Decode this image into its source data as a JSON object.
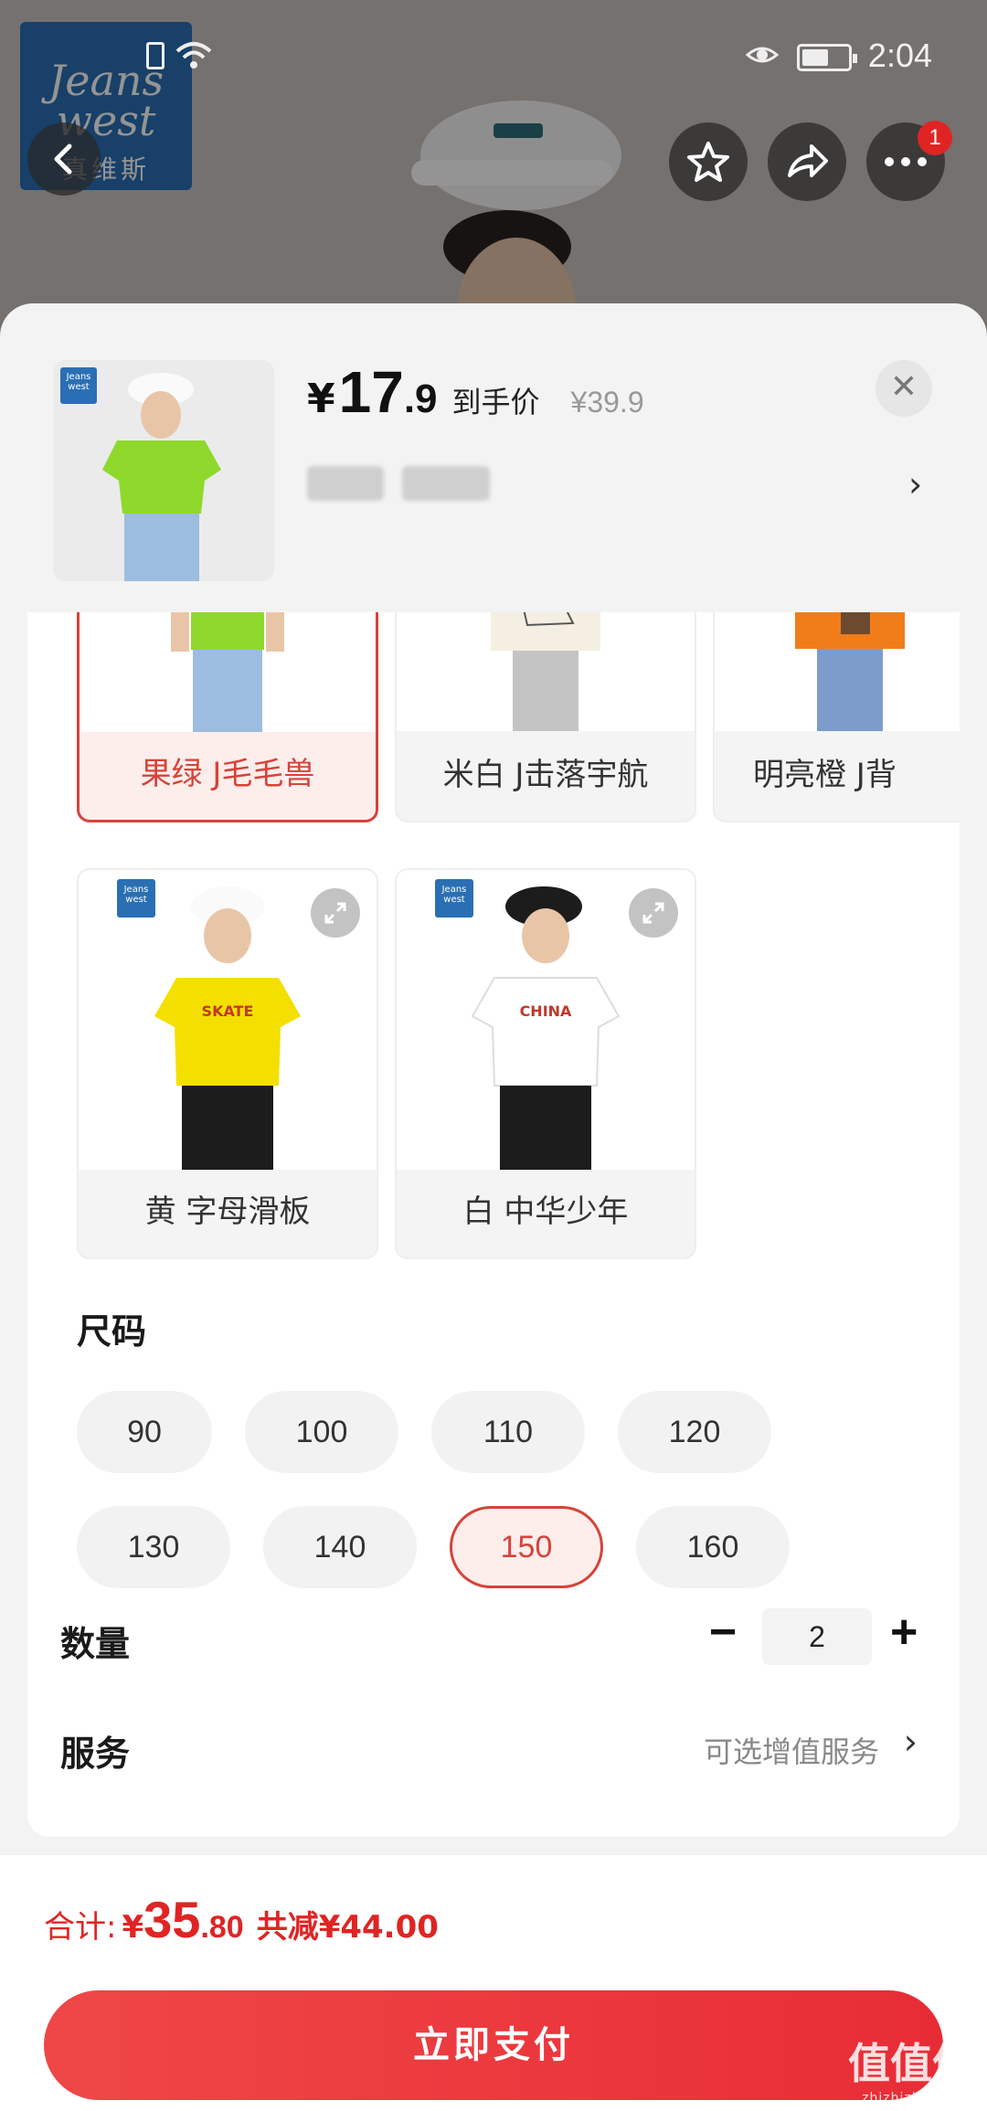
{
  "status_bar": {
    "time": "2:04"
  },
  "brand": {
    "logo_line1": "Jeans",
    "logo_line2": "west",
    "logo_cn": "真维斯"
  },
  "cart_badge": "1",
  "sheet": {
    "price_currency": "¥",
    "price_int": "17",
    "price_dec": ".9",
    "price_tag": "到手价",
    "original_price": "¥39.9",
    "close_icon": "✕"
  },
  "colors": [
    {
      "label": "果绿 J毛毛兽",
      "selected": true,
      "shirt": "#8fd92c",
      "pants": "#8fb3d9"
    },
    {
      "label": "米白 J击落宇航",
      "selected": false,
      "shirt": "#f4efe2",
      "pants": "#bdbdbd"
    },
    {
      "label": "明亮橙 J背",
      "selected": false,
      "shirt": "#f07d1a",
      "pants": "#7d9ccc"
    },
    {
      "label": "黄 字母滑板",
      "selected": false,
      "shirt": "#f3e000",
      "pants": "#1c1c1c"
    },
    {
      "label": "白 中华少年",
      "selected": false,
      "shirt": "#ffffff",
      "pants": "#1c1c1c"
    }
  ],
  "size": {
    "title": "尺码",
    "options": [
      "90",
      "100",
      "110",
      "120",
      "130",
      "140",
      "150",
      "160"
    ],
    "selected": "150"
  },
  "quantity": {
    "title": "数量",
    "minus": "−",
    "value": "2",
    "plus": "+"
  },
  "service": {
    "title": "服务",
    "hint": "可选增值服务",
    "chevron": "›"
  },
  "footer": {
    "total_label": "合计:",
    "total_currency": "¥",
    "total_int": "35",
    "total_dec": ".80",
    "discount": "共减¥44.00",
    "pay_label": "立即支付"
  },
  "watermark": {
    "main": "值值值",
    "sub": "zhizhizhi.com"
  },
  "accent_color": "#d6433a"
}
